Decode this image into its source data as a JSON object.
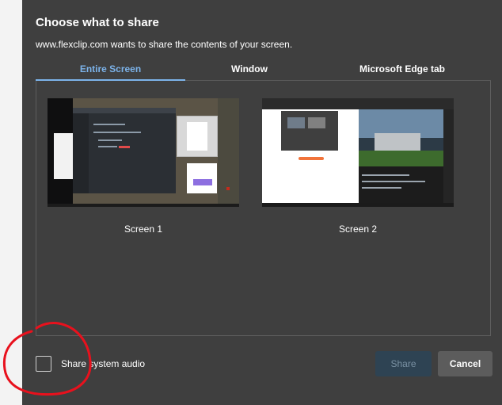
{
  "dialog": {
    "title": "Choose what to share",
    "subtitle": "www.flexclip.com wants to share the contents of your screen.",
    "tabs": [
      {
        "label": "Entire Screen",
        "active": true
      },
      {
        "label": "Window",
        "active": false
      },
      {
        "label": "Microsoft Edge tab",
        "active": false
      }
    ],
    "screens": [
      {
        "label": "Screen 1"
      },
      {
        "label": "Screen 2"
      }
    ],
    "audio_checkbox": {
      "label": "Share system audio",
      "checked": false
    },
    "buttons": {
      "share": "Share",
      "cancel": "Cancel"
    }
  },
  "colors": {
    "dialog_bg": "#3f3f3f",
    "accent": "#7cb3ea",
    "annotation_red": "#e8111d",
    "share_disabled": "#2e4353"
  },
  "annotation": {
    "shape": "hand-drawn red circle around audio checkbox"
  }
}
